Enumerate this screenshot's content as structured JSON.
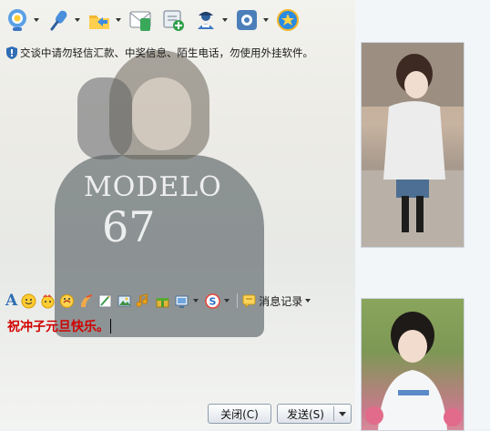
{
  "toolbar": {
    "items": [
      {
        "name": "video-call",
        "icon": "webcam-icon",
        "has_dropdown": true
      },
      {
        "name": "voice-call",
        "icon": "microphone-icon",
        "has_dropdown": true
      },
      {
        "name": "send-file",
        "icon": "folder-transfer-icon",
        "has_dropdown": true
      },
      {
        "name": "send-sms",
        "icon": "mail-phone-icon",
        "has_dropdown": false
      },
      {
        "name": "create-discussion",
        "icon": "add-group-icon",
        "has_dropdown": false
      },
      {
        "name": "contact-info",
        "icon": "user-card-icon",
        "has_dropdown": true
      },
      {
        "name": "apps",
        "icon": "app-box-icon",
        "has_dropdown": true
      },
      {
        "name": "qzone",
        "icon": "star-circle-icon",
        "has_dropdown": false
      }
    ]
  },
  "notice": {
    "text": "交谈中请勿轻信汇款、中奖信息、陌生电话，勿使用外挂软件。",
    "icon": "shield-icon"
  },
  "input_toolbar": {
    "font_label": "A",
    "history_label": "消息记录"
  },
  "message_input": {
    "value": "祝冲子元旦快乐。",
    "color": "#d00000"
  },
  "buttons": {
    "close_label": "关闭(C)",
    "send_label": "发送(S)"
  },
  "colors": {
    "accent": "#2f6db4",
    "message_text": "#d00000"
  }
}
